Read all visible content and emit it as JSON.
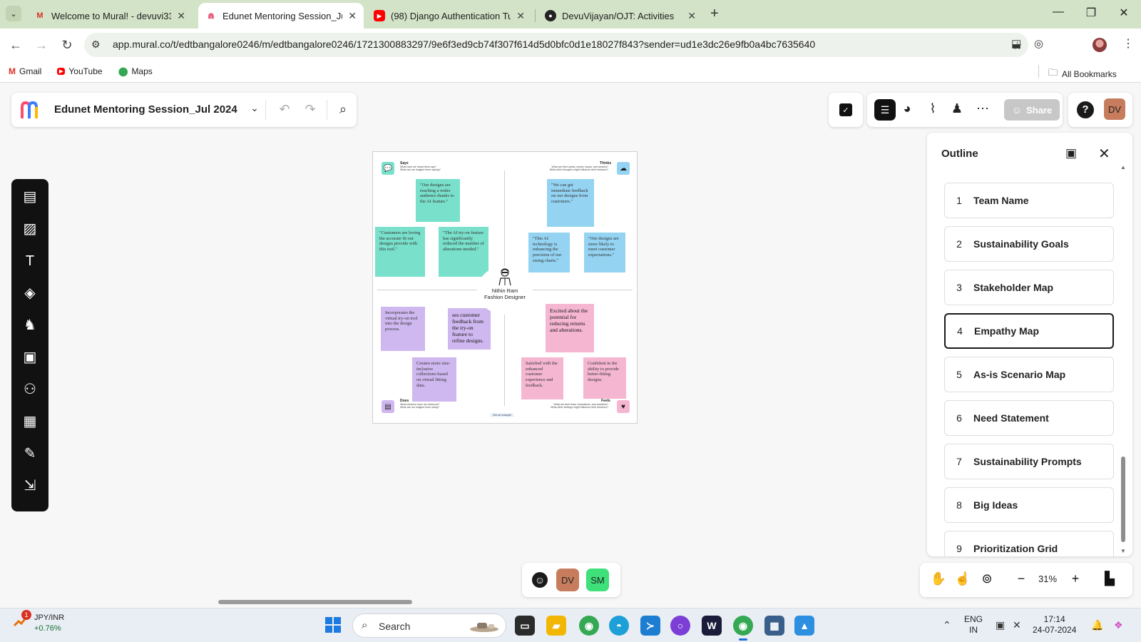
{
  "browser": {
    "tabs": [
      {
        "title": "Welcome to Mural! - devuvi338",
        "favicon": "gmail-icon",
        "active": false
      },
      {
        "title": "Edunet Mentoring Session_Jul 2",
        "favicon": "mural-icon",
        "active": true
      },
      {
        "title": "(98) Django Authentication Tuto",
        "favicon": "youtube-icon",
        "active": false
      },
      {
        "title": "DevuVijayan/OJT: Activities",
        "favicon": "github-icon",
        "active": false
      }
    ],
    "url": "app.mural.co/t/edtbangalore0246/m/edtbangalore0246/1721300883297/9e6f3ed9cb74f307f614d5d0bfc0d1e18027f843?sender=ud1e3dc26e9fb0a4bc7635640",
    "bookmarks": [
      {
        "label": "Gmail",
        "icon": "gmail-icon"
      },
      {
        "label": "YouTube",
        "icon": "youtube-icon"
      },
      {
        "label": "Maps",
        "icon": "maps-icon"
      }
    ],
    "all_bookmarks": "All Bookmarks"
  },
  "mural": {
    "board_title": "Edunet Mentoring Session_Jul 2024",
    "share_label": "Share",
    "user_initials": "DV",
    "zoom": "31%",
    "collaborators": [
      {
        "initials": "DV",
        "color": "#c77d5d"
      },
      {
        "initials": "SM",
        "color": "#3ee07a"
      }
    ]
  },
  "board": {
    "quadrants": {
      "says": {
        "label": "Says",
        "sub": "What have we heard them say?\nWhat can we imagine them saying?"
      },
      "thinks": {
        "label": "Thinks",
        "sub": "What are their wants, needs, hopes, and dreams?\nWhat other thoughts might influence their behavior?"
      },
      "does": {
        "label": "Does",
        "sub": "What behavior have we observed?\nWhat can we imagine them doing?"
      },
      "feels": {
        "label": "Feels",
        "sub": "What are their fears, frustrations, and anxieties?\nWhat other feelings might influence their behavior?"
      }
    },
    "persona": {
      "name": "Nithin Ram",
      "role": "Fashion Designer"
    },
    "stickies": {
      "s1": "\"Our designs are reaching a wider audience thanks to the AI feature.\"",
      "s2": "\"Customers are loving the accurate fit our designs provide with this tool.\"",
      "s3": "\"The AI try-on feature has significantly reduced the number of alterations needed.\"",
      "t1": "\"We can get immediate feedback on our designs from customers.\"",
      "t2": "\"This AI technology is enhancing the precision of our sizing charts.\"",
      "t3": "\"Our designs are more likely to meet customer expectations.\"",
      "d1": "Incorporates the virtual try-on tool into the design process.",
      "d2": "ses customer feedback from the try-on feature to refine designs.",
      "d3": "Creates more size-inclusive collections based on virtual fitting data.",
      "f1": "Excited about the potential for reducing returns and alterations.",
      "f2": "Satisfied with the enhanced customer experience and feedback.",
      "f3": "Confident in the ability to provide better-fitting designs."
    },
    "footer": "See an example"
  },
  "outline": {
    "title": "Outline",
    "items": [
      {
        "num": "1",
        "label": "Team Name"
      },
      {
        "num": "2",
        "label": "Sustainability Goals"
      },
      {
        "num": "3",
        "label": "Stakeholder Map"
      },
      {
        "num": "4",
        "label": "Empathy Map"
      },
      {
        "num": "5",
        "label": "As-is Scenario Map"
      },
      {
        "num": "6",
        "label": "Need Statement"
      },
      {
        "num": "7",
        "label": "Sustainability Prompts"
      },
      {
        "num": "8",
        "label": "Big Ideas"
      },
      {
        "num": "9",
        "label": "Prioritization Grid"
      }
    ],
    "active_index": 3
  },
  "taskbar": {
    "ticker_symbol": "JPY/INR",
    "ticker_change": "+0.76%",
    "notification_count": "1",
    "search_placeholder": "Search",
    "lang_1": "ENG",
    "lang_2": "IN",
    "time": "17:14",
    "date": "24-07-2024"
  }
}
